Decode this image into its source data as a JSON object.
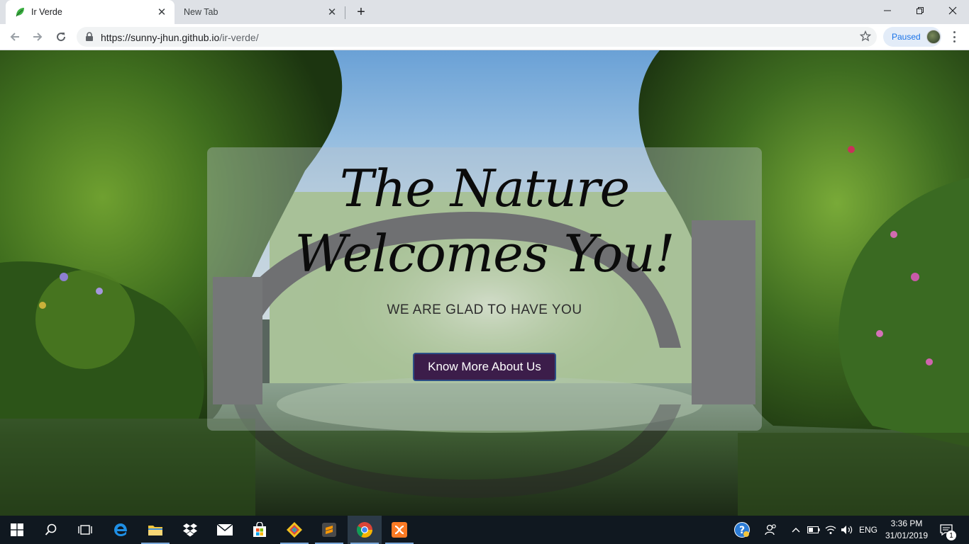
{
  "browser": {
    "tabs": [
      {
        "title": "Ir Verde",
        "active": true
      },
      {
        "title": "New Tab",
        "active": false
      }
    ],
    "url": {
      "host": "https://sunny-jhun.github.io",
      "path": "/ir-verde/"
    },
    "profile_status": "Paused"
  },
  "hero": {
    "title": "The Nature Welcomes You!",
    "subtitle": "WE ARE GLAD TO HAVE YOU",
    "cta_label": "Know More About Us"
  },
  "taskbar": {
    "apps": [
      "windows-start",
      "search",
      "task-view",
      "edge",
      "file-explorer",
      "dropbox",
      "mail",
      "store",
      "git",
      "sublime-text",
      "chrome",
      "xampp"
    ],
    "language": "ENG",
    "time": "3:36 PM",
    "date": "31/01/2019",
    "notification_count": "1"
  }
}
